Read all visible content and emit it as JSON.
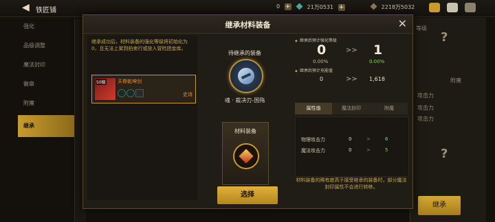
{
  "topbar": {
    "title": "铁匠铺",
    "currency1": "0",
    "currency2": "21万0531",
    "currency3": "2218万5032"
  },
  "sidebar": {
    "items": [
      {
        "label": "强化"
      },
      {
        "label": "品级调整"
      },
      {
        "label": "魔法封印"
      },
      {
        "label": "徽章"
      },
      {
        "label": "附魔"
      },
      {
        "label": "继承"
      }
    ]
  },
  "background": {
    "right_label": "等级",
    "right_label2": "附魔",
    "right_stat1": "攻击力",
    "right_stat2": "攻击力",
    "right_stat3": "攻击力",
    "bottom_button": "继承"
  },
  "dialog": {
    "title": "继承材料装备",
    "notice": "继承成功后，材料装备的强化等级将初始化为0，且无法上架到拍卖行或放入冒险团金库。",
    "item": {
      "level": "50级",
      "name": "天脊乾坤剑",
      "rarity": "史诗"
    },
    "middle": {
      "target_label": "待继承的装备",
      "target_name": "魂 · 裁决刃-国殇",
      "material_label": "材料装备"
    },
    "right": {
      "enhance_label": "继承后预计强化等级",
      "enhance_from": "0",
      "enhance_from_pct": "0.00%",
      "enhance_to": "1",
      "enhance_to_pct": "0.00%",
      "charge_label": "继承后预计充能值",
      "charge_from": "0",
      "charge_to": "1,618",
      "tabs": [
        "属性值",
        "魔法封印",
        "附魔"
      ],
      "rows": [
        {
          "label": "物理攻击力",
          "from": "0",
          "to": "6"
        },
        {
          "label": "魔法攻击力",
          "from": "0",
          "to": "5"
        }
      ],
      "warning": "材料装备的稀有度高于接受继承的装备时，部分魔法封印属性不会进行转移。"
    },
    "select_button": "选择"
  },
  "colors": {
    "accent": "#c89b2c",
    "increase": "#7fdc4e"
  }
}
